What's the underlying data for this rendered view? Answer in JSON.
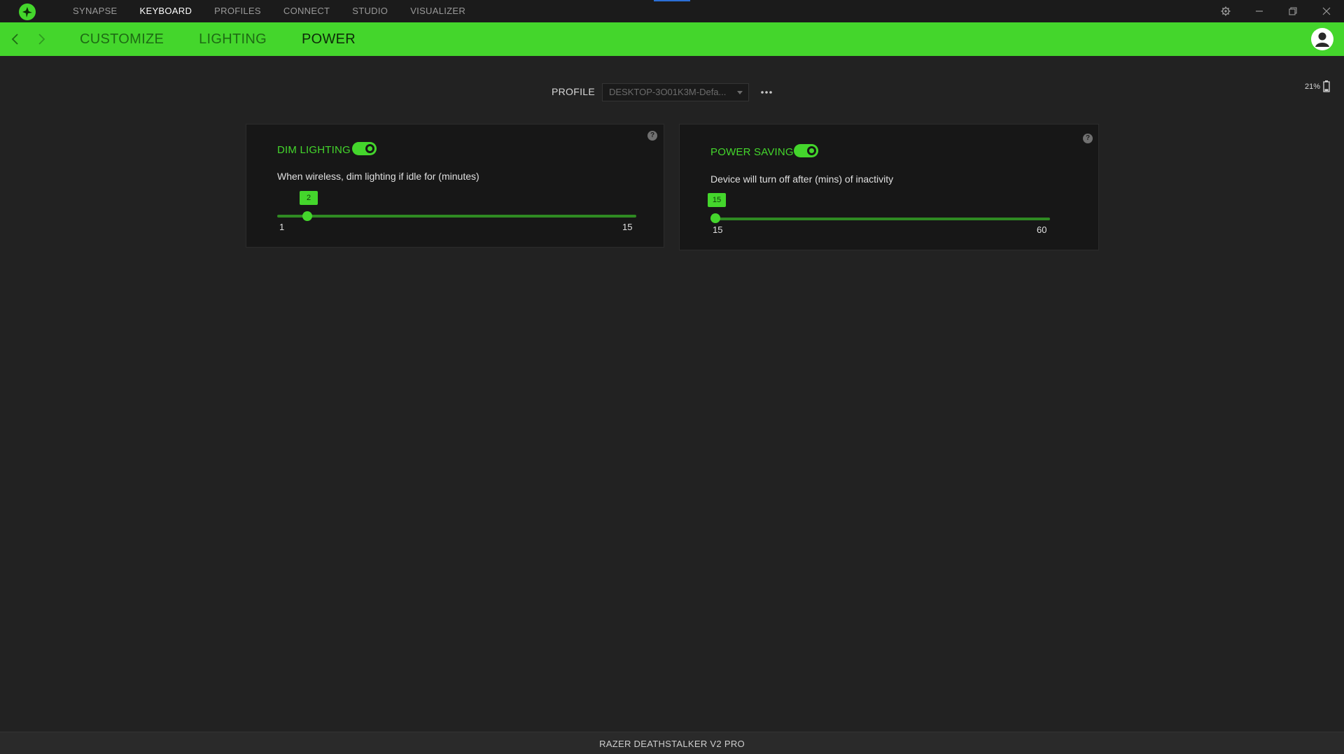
{
  "topnav": {
    "items": [
      {
        "label": "SYNAPSE",
        "active": false
      },
      {
        "label": "KEYBOARD",
        "active": true
      },
      {
        "label": "PROFILES",
        "active": false
      },
      {
        "label": "CONNECT",
        "active": false
      },
      {
        "label": "STUDIO",
        "active": false
      },
      {
        "label": "VISUALIZER",
        "active": false
      }
    ]
  },
  "window_controls": [
    "gear-icon",
    "minimize-icon",
    "restore-icon",
    "close-icon"
  ],
  "subnav": {
    "tabs": [
      {
        "label": "CUSTOMIZE",
        "active": false
      },
      {
        "label": "LIGHTING",
        "active": false
      },
      {
        "label": "POWER",
        "active": true
      }
    ]
  },
  "profile": {
    "label": "PROFILE",
    "selected": "DESKTOP-3O01K3M-Defa..."
  },
  "battery": {
    "level_text": "21%",
    "level": 0.21
  },
  "dim_lighting": {
    "title": "DIM LIGHTING",
    "enabled": true,
    "description": "When wireless, dim lighting if idle for (minutes)",
    "value": "2",
    "min": "1",
    "max": "15"
  },
  "power_saving": {
    "title": "POWER SAVING",
    "enabled": true,
    "description": "Device will turn off after (mins) of inactivity",
    "value": "15",
    "min": "15",
    "max": "60"
  },
  "footer": {
    "device_name": "RAZER DEATHSTALKER V2 PRO"
  },
  "colors": {
    "accent": "#44d62c",
    "background": "#222222",
    "card": "#171717"
  }
}
